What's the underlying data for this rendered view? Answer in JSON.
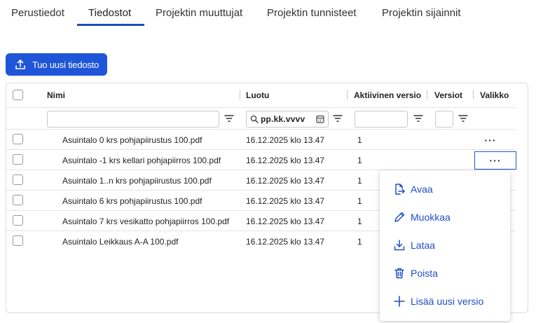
{
  "tabs": [
    {
      "label": "Perustiedot"
    },
    {
      "label": "Tiedostot",
      "active": true
    },
    {
      "label": "Projektin muuttujat"
    },
    {
      "label": "Projektin tunnisteet"
    },
    {
      "label": "Projektin sijainnit"
    }
  ],
  "upload_button": {
    "label": "Tuo uusi tiedosto",
    "icon": "upload-icon"
  },
  "table": {
    "columns": {
      "name": "Nimi",
      "created": "Luotu",
      "active_version": "Aktiivinen versio",
      "versions": "Versiot",
      "menu": "Valikko"
    },
    "filters": {
      "name_value": "",
      "date_placeholder": "pp.kk.vvvv",
      "active_version_value": "",
      "versions_value": ""
    },
    "rows": [
      {
        "name": "Asuintalo 0 krs pohjapiirustus 100.pdf",
        "created": "16.12.2025 klo 13.47",
        "active_version": "1",
        "menu": "···"
      },
      {
        "name": "Asuintalo -1 krs kellari pohjapiirros 100.pdf",
        "created": "16.12.2025 klo 13.47",
        "active_version": "1",
        "menu": "···"
      },
      {
        "name": "Asuintalo 1..n krs pohjapiirustus 100.pdf",
        "created": "16.12.2025 klo 13.47",
        "active_version": "1",
        "menu": ""
      },
      {
        "name": "Asuintalo 6 krs pohjapiirustus 100.pdf",
        "created": "16.12.2025 klo 13.47",
        "active_version": "1",
        "menu": ""
      },
      {
        "name": "Asuintalo 7 krs vesikatto pohjapiirros 100.pdf",
        "created": "16.12.2025 klo 13.47",
        "active_version": "1",
        "menu": ""
      },
      {
        "name": "Asuintalo Leikkaus A-A 100.pdf",
        "created": "16.12.2025 klo 13.47",
        "active_version": "1",
        "menu": ""
      }
    ]
  },
  "context_menu": {
    "items": [
      {
        "label": "Avaa",
        "icon": "open-file-icon"
      },
      {
        "label": "Muokkaa",
        "icon": "pencil-icon"
      },
      {
        "label": "Lataa",
        "icon": "download-icon"
      },
      {
        "label": "Poista",
        "icon": "trash-icon"
      },
      {
        "label": "Lisää uusi versio",
        "icon": "plus-icon"
      }
    ]
  },
  "colors": {
    "accent": "#1f55d8",
    "menu_text": "#1f4ec9",
    "tab_underline": "#1a4fba"
  }
}
